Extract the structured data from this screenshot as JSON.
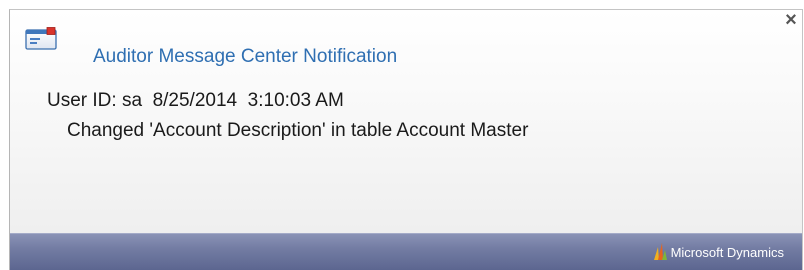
{
  "notification": {
    "title": "Auditor Message Center Notification",
    "user_line": "User ID: sa  8/25/2014  3:10:03 AM",
    "message": "Changed 'Account Description' in table Account Master",
    "close_glyph": "×",
    "close_icon": "close-icon",
    "header_icon": "envelope-icon"
  },
  "footer": {
    "brand": "Microsoft Dynamics",
    "logo_icon": "microsoft-dynamics-logo"
  },
  "colors": {
    "title": "#2f6fb2",
    "footer_bar": "#737ca3",
    "text": "#1a1a1a"
  }
}
